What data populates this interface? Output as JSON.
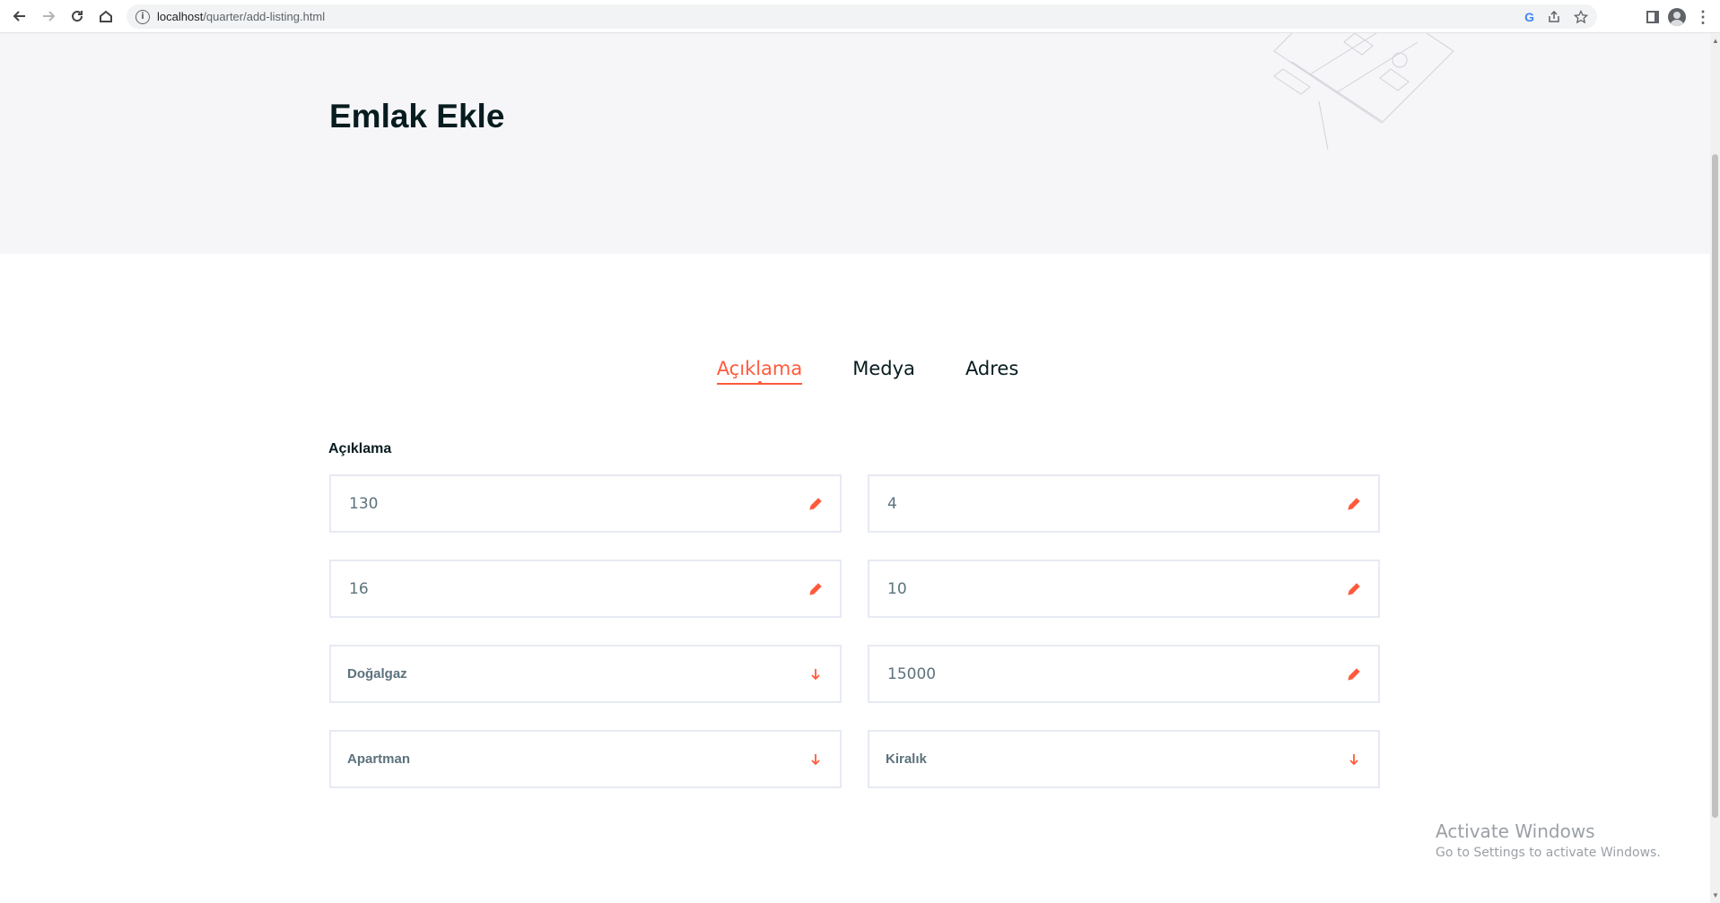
{
  "browser": {
    "url_host": "localhost",
    "url_path": "/quarter/add-listing.html",
    "google_icon_label": "G"
  },
  "page": {
    "title": "Emlak Ekle"
  },
  "tabs": [
    {
      "label": "Açıklama",
      "active": true
    },
    {
      "label": "Medya",
      "active": false
    },
    {
      "label": "Adres",
      "active": false
    }
  ],
  "section": {
    "label": "Açıklama"
  },
  "fields": [
    {
      "value": "130",
      "kind": "input",
      "icon": "pencil-icon"
    },
    {
      "value": "4",
      "kind": "input",
      "icon": "pencil-icon"
    },
    {
      "value": "16",
      "kind": "input",
      "icon": "pencil-icon"
    },
    {
      "value": "10",
      "kind": "input",
      "icon": "pencil-icon"
    },
    {
      "value": "Doğalgaz",
      "kind": "select",
      "icon": "arrow-down-icon"
    },
    {
      "value": "15000",
      "kind": "input",
      "icon": "pencil-icon"
    },
    {
      "value": "Apartman",
      "kind": "select",
      "icon": "arrow-down-icon"
    },
    {
      "value": "Kiralık",
      "kind": "select",
      "icon": "arrow-down-icon"
    }
  ],
  "watermark": {
    "line1": "Activate Windows",
    "line2": "Go to Settings to activate Windows."
  },
  "colors": {
    "accent": "#ff5a3c",
    "heading": "#071c1f",
    "hero_bg": "#f6f6f9",
    "field_border": "#e7eaf3"
  }
}
